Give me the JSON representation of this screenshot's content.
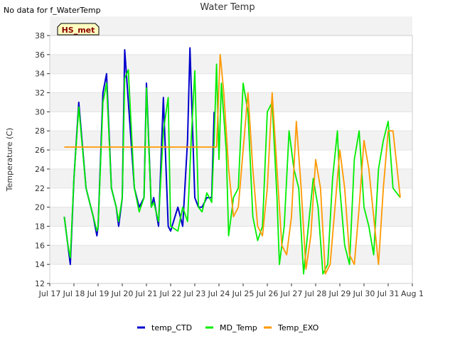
{
  "header": {
    "no_data_text": "No data for f_WaterTemp"
  },
  "chart_data": {
    "type": "line",
    "title": "Water Temp",
    "xlabel": "",
    "ylabel": "Temperature (C)",
    "ylim": [
      12,
      38
    ],
    "yticks": [
      12,
      14,
      16,
      18,
      20,
      22,
      24,
      26,
      28,
      30,
      32,
      34,
      36,
      38
    ],
    "xlim": [
      17,
      32
    ],
    "xticks": [
      17,
      18,
      19,
      20,
      21,
      22,
      23,
      24,
      25,
      26,
      27,
      28,
      29,
      30,
      31,
      32
    ],
    "xtick_labels": [
      "Jul 17",
      "Jul 18",
      "Jul 19",
      "Jul 20",
      "Jul 21",
      "Jul 22",
      "Jul 23",
      "Jul 24",
      "Jul 25",
      "Jul 26",
      "Jul 27",
      "Jul 28",
      "Jul 29",
      "Jul 30",
      "Jul 31",
      "Aug 1"
    ],
    "grid": true,
    "legend_position": "bottom",
    "badge": {
      "text": "HS_met",
      "bg": "#ffffc0",
      "border": "#000000",
      "color": "#8b0000"
    },
    "series": [
      {
        "name": "temp_CTD",
        "color": "#0000cc",
        "x": [
          17.6,
          17.75,
          17.85,
          18.0,
          18.2,
          18.5,
          18.8,
          18.95,
          19.0,
          19.2,
          19.35,
          19.55,
          19.75,
          19.85,
          20.0,
          20.1,
          20.5,
          20.7,
          20.9,
          21.0,
          21.2,
          21.3,
          21.5,
          21.7,
          21.9,
          22.0,
          22.3,
          22.5,
          22.7,
          22.8,
          23.0,
          23.15,
          23.3,
          23.5,
          23.7,
          23.8
        ],
        "y": [
          19,
          16,
          14,
          23,
          31,
          22,
          19,
          17,
          18,
          32,
          34,
          22,
          20,
          18,
          21,
          36.5,
          22,
          20,
          21,
          33,
          20,
          21,
          18,
          31.5,
          18,
          17.5,
          20,
          18,
          27,
          36.7,
          21,
          20,
          20,
          21,
          21,
          30
        ]
      },
      {
        "name": "MD_Temp",
        "color": "#00ee00",
        "x": [
          17.6,
          17.75,
          17.85,
          18.0,
          18.2,
          18.5,
          18.8,
          18.95,
          19.0,
          19.2,
          19.35,
          19.55,
          19.75,
          19.85,
          20.0,
          20.1,
          20.25,
          20.5,
          20.7,
          20.9,
          21.0,
          21.2,
          21.3,
          21.5,
          21.7,
          21.9,
          22.0,
          22.3,
          22.5,
          22.7,
          22.85,
          23.0,
          23.15,
          23.3,
          23.5,
          23.7,
          23.8,
          23.9,
          24.0,
          24.1,
          24.3,
          24.4,
          24.6,
          24.8,
          25.0,
          25.2,
          25.4,
          25.6,
          25.8,
          26.0,
          26.2,
          26.4,
          26.5,
          26.7,
          26.9,
          27.1,
          27.3,
          27.5,
          27.7,
          27.9,
          28.1,
          28.3,
          28.5,
          28.7,
          28.9,
          29.0,
          29.2,
          29.4,
          29.6,
          29.8,
          30.0,
          30.2,
          30.4,
          30.6,
          30.8,
          31.0,
          31.2,
          31.5
        ],
        "y": [
          19,
          16,
          14.7,
          23,
          30.5,
          22,
          19,
          17.5,
          18,
          31,
          33,
          22,
          20,
          18.5,
          21,
          33.5,
          34.4,
          22,
          19.5,
          21,
          32.5,
          20,
          20.5,
          18.5,
          28,
          31.5,
          18,
          17.5,
          20,
          18.5,
          27,
          34.3,
          20,
          19.5,
          21.5,
          20.5,
          27,
          35,
          25,
          33,
          26,
          17,
          21,
          22,
          33,
          30,
          19,
          16.5,
          18,
          30,
          31,
          21,
          14,
          18,
          28,
          24,
          22,
          13,
          18,
          23,
          20,
          13,
          14,
          23,
          28,
          22,
          16,
          14,
          25,
          28,
          20,
          18,
          15,
          24,
          27,
          29,
          22,
          21
        ]
      },
      {
        "name": "Temp_EXO",
        "color": "#ff9900",
        "x": [
          17.6,
          23.9,
          24.05,
          24.2,
          24.4,
          24.6,
          24.8,
          25.0,
          25.2,
          25.4,
          25.6,
          25.8,
          26.0,
          26.2,
          26.4,
          26.6,
          26.8,
          27.0,
          27.2,
          27.4,
          27.6,
          27.8,
          28.0,
          28.2,
          28.4,
          28.6,
          28.8,
          29.0,
          29.2,
          29.4,
          29.6,
          29.8,
          30.0,
          30.2,
          30.4,
          30.6,
          30.8,
          31.0,
          31.2,
          31.5
        ],
        "y": [
          26.3,
          26.3,
          36,
          32,
          24,
          19,
          20,
          26,
          32,
          24,
          18,
          17,
          22,
          32,
          24,
          16,
          15,
          19,
          29,
          22,
          13.5,
          17,
          25,
          22,
          13,
          14,
          20,
          26,
          22,
          15,
          14,
          20,
          27,
          24,
          19,
          14,
          22,
          28,
          28,
          21
        ]
      }
    ]
  }
}
